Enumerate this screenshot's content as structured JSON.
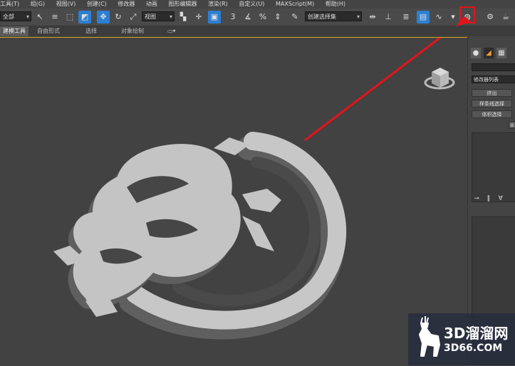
{
  "menu": [
    "工具(T)",
    "组(G)",
    "视图(V)",
    "创建(C)",
    "修改器",
    "动画",
    "图形编辑器",
    "渲染(R)",
    "自定义(U)",
    "MAXScript(M)",
    "帮助(H)"
  ],
  "toolbar": {
    "selection_filter": "全部",
    "reference_coord": "视图",
    "named_selection": "创建选择集",
    "snap_label": "3",
    "angle_snap_label": "%"
  },
  "ribbon_tabs": [
    "建模工具",
    "自由形式",
    "选择",
    "对象绘制"
  ],
  "command_panel": {
    "tabs": [
      "create-icon",
      "modify-icon",
      "hierarchy-icon"
    ],
    "modifier_list_label": "修改器列表",
    "buttons": [
      "挤出",
      "样条线选择",
      "体积选择"
    ]
  },
  "watermark": {
    "cn": "3D溜溜网",
    "en": "3D66.COM"
  },
  "colors": {
    "accent_blue": "#2d7fd1",
    "highlight_red": "#e2141b",
    "viewport_border": "#d6a317"
  }
}
